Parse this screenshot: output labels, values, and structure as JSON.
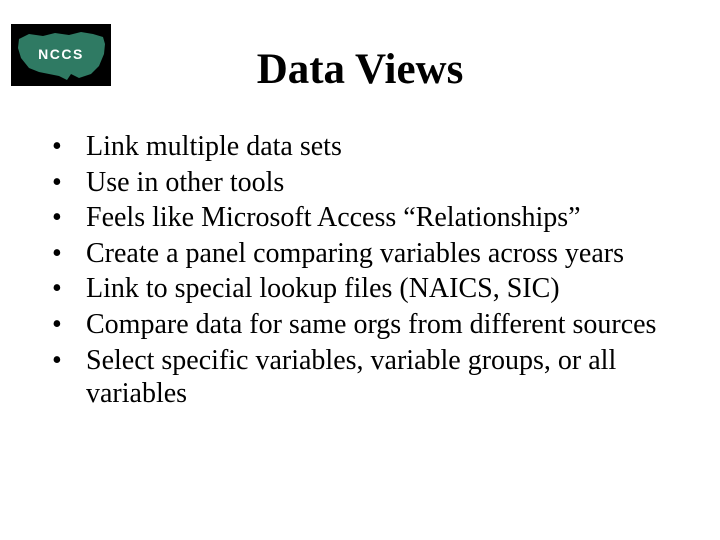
{
  "logo": {
    "text": "NCCS"
  },
  "title": "Data Views",
  "bullets": [
    "Link multiple data sets",
    "Use in other tools",
    "Feels like Microsoft Access “Relationships”",
    "Create a panel comparing variables across years",
    "Link to special lookup files (NAICS, SIC)",
    "Compare data for same orgs from different sources",
    "Select specific variables, variable groups, or all variables"
  ]
}
